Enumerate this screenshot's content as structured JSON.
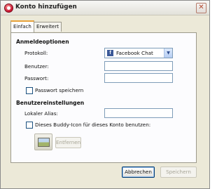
{
  "window": {
    "title": "Konto hinzufügen",
    "close_glyph": "✕"
  },
  "tabs": [
    {
      "label": "Einfach",
      "active": true
    },
    {
      "label": "Erweitert",
      "active": false
    }
  ],
  "login_options": {
    "heading": "Anmeldeoptionen",
    "protocol_label": "Protokoll:",
    "protocol_value": "Facebook Chat",
    "protocol_icon": "facebook-icon",
    "username_label": "Benutzer:",
    "username_value": "",
    "password_label": "Passwort:",
    "password_value": "",
    "save_password_label": "Passwort speichern",
    "save_password_checked": false
  },
  "user_settings": {
    "heading": "Benutzereinstellungen",
    "local_alias_label": "Lokaler Alias:",
    "local_alias_value": "",
    "buddy_icon_label": "Dieses Buddy-Icon für dieses Konto benutzen:",
    "buddy_icon_checked": false,
    "remove_label": "Entfernen"
  },
  "footer": {
    "cancel_label": "Abbrechen",
    "save_label": "Speichern"
  },
  "colors": {
    "window_bg": "#ece9d8",
    "panel_bg": "#fcfcfe",
    "active_tab_accent": "#e8a23a",
    "input_border": "#7f9db9",
    "facebook_blue": "#3b5998"
  }
}
